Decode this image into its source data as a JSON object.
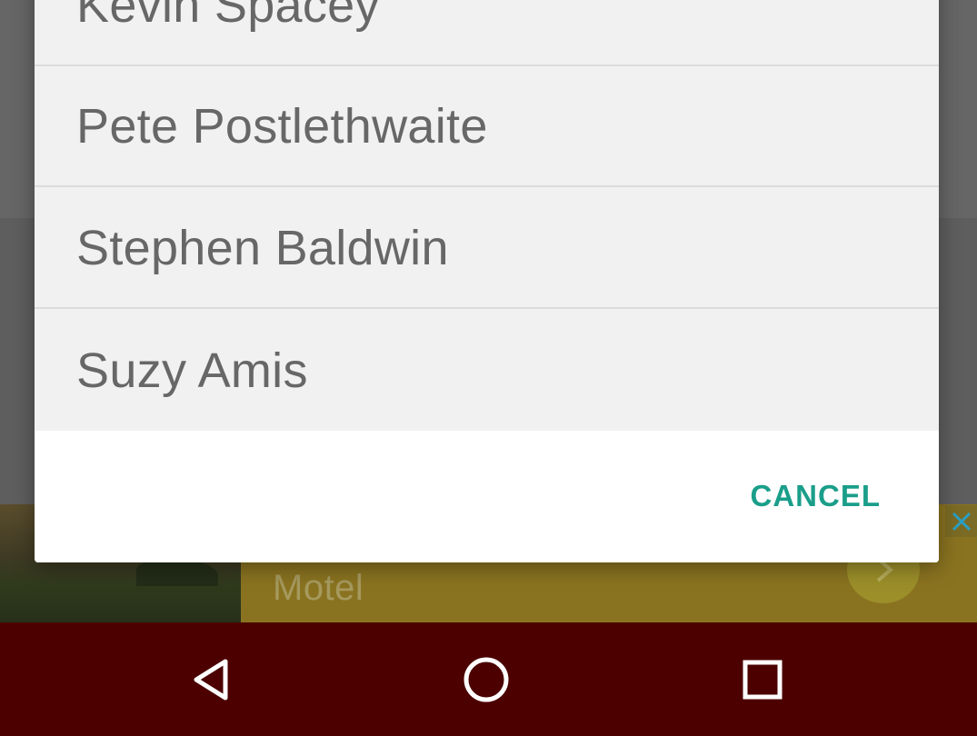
{
  "dialog": {
    "items": [
      {
        "label": "Kevin Spacey"
      },
      {
        "label": "Pete Postlethwaite"
      },
      {
        "label": "Stephen Baldwin"
      },
      {
        "label": "Suzy Amis"
      }
    ],
    "cancel_label": "CANCEL"
  },
  "ad": {
    "title": "Motel",
    "close_icon": "close-icon",
    "arrow_icon": "chevron-right-icon"
  },
  "navbar": {
    "back_icon": "back-triangle-icon",
    "home_icon": "home-circle-icon",
    "recents_icon": "recents-square-icon"
  },
  "colors": {
    "accent": "#1a9e8a",
    "navbar": "#4c0000",
    "list_background": "#f1f1f1",
    "list_text": "#676767"
  }
}
